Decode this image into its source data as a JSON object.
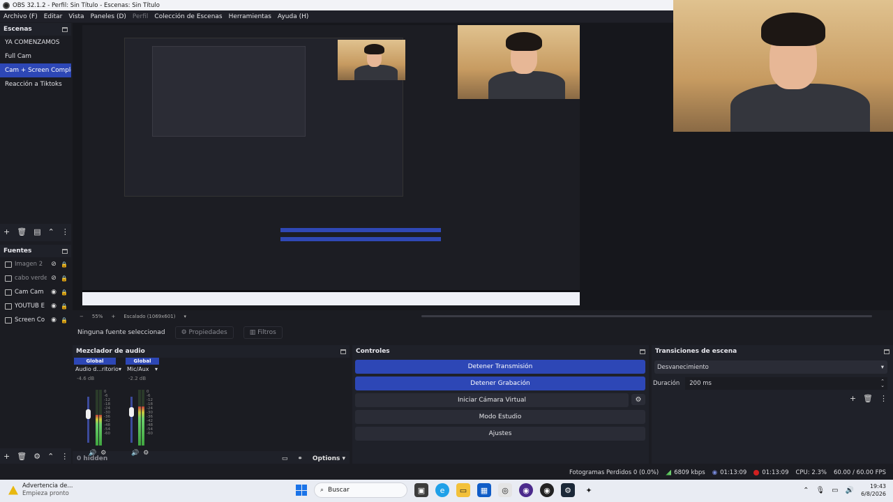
{
  "window": {
    "title": "OBS 32.1.2 - Perfil: Sin Título - Escenas: Sin Título"
  },
  "menu": [
    {
      "label": "Archivo (F)",
      "enabled": true
    },
    {
      "label": "Editar",
      "enabled": true
    },
    {
      "label": "Vista",
      "enabled": true
    },
    {
      "label": "Paneles (D)",
      "enabled": true
    },
    {
      "label": "Perfil",
      "enabled": false
    },
    {
      "label": "Colección de Escenas",
      "enabled": true
    },
    {
      "label": "Herramientas",
      "enabled": true
    },
    {
      "label": "Ayuda (H)",
      "enabled": true
    }
  ],
  "scenes": {
    "header": "Escenas",
    "items": [
      {
        "label": "YA COMENZAMOS",
        "selected": false
      },
      {
        "label": "Full Cam",
        "selected": false
      },
      {
        "label": "Cam + Screen Completa",
        "selected": true
      },
      {
        "label": "Reacción a Tiktoks",
        "selected": false
      }
    ]
  },
  "sources": {
    "header": "Fuentes",
    "items": [
      {
        "label": "Imagen 2",
        "visible": false
      },
      {
        "label": "cabo verde",
        "visible": false
      },
      {
        "label": "Cam Cam",
        "visible": true
      },
      {
        "label": "YOUTUB E",
        "visible": true
      },
      {
        "label": "Screen Co",
        "visible": true
      }
    ]
  },
  "preview": {
    "zoom": "55%",
    "scaling": "Escalado (1069x601)"
  },
  "properties_bar": {
    "no_source": "Ninguna fuente seleccionad",
    "properties": "Propiedades",
    "filters": "Filtros"
  },
  "mixer": {
    "header": "Mezclador de audio",
    "channels": [
      {
        "global": "Global",
        "name": "Audio d...ritorio",
        "db": "-4.6 dB",
        "level": 0.55,
        "fader": 0.72
      },
      {
        "global": "Global",
        "name": "Mic/Aux",
        "db": "-2.2 dB",
        "level": 0.7,
        "fader": 0.78
      }
    ],
    "ticks": [
      "0",
      "-6",
      "-12",
      "-18",
      "-24",
      "-30",
      "-36",
      "-42",
      "-48",
      "-54",
      "-60"
    ],
    "hidden": "0 hidden",
    "options": "Options"
  },
  "controls": {
    "header": "Controles",
    "buttons": [
      {
        "label": "Detener Transmisión",
        "active": true
      },
      {
        "label": "Detener Grabación",
        "active": true
      },
      {
        "label": "Iniciar Cámara Virtual",
        "active": false
      },
      {
        "label": "Modo Estudio",
        "active": false
      },
      {
        "label": "Ajustes",
        "active": false
      }
    ]
  },
  "transitions": {
    "header": "Transiciones de escena",
    "selected": "Desvanecimiento",
    "duration_label": "Duración",
    "duration_value": "200 ms"
  },
  "status": {
    "dropped": "Fotogramas Perdidos 0 (0.0%)",
    "bitrate": "6809 kbps",
    "stream_time": "01:13:09",
    "rec_time": "01:13:09",
    "cpu": "CPU: 2.3%",
    "fps": "60.00 / 60.00 FPS"
  },
  "taskbar": {
    "warning_title": "Advertencia de...",
    "warning_sub": "Empieza pronto",
    "search_placeholder": "Buscar",
    "time": "19:43",
    "date": "6/8/2026"
  },
  "colors": {
    "accent": "#2d47b6",
    "panel": "#1f2129",
    "background": "#1b1c22",
    "recording": "#d12020"
  }
}
